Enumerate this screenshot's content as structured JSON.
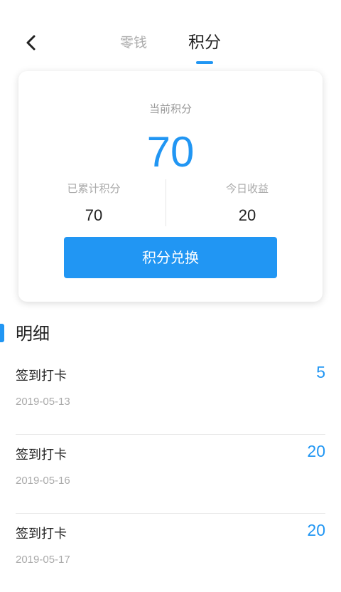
{
  "header": {
    "tabs": [
      {
        "label": "零钱",
        "active": false
      },
      {
        "label": "积分",
        "active": true
      }
    ],
    "back_icon": "chevron-left-icon"
  },
  "card": {
    "current_label": "当前积分",
    "current_value": "70",
    "stats": [
      {
        "label": "已累计积分",
        "value": "70"
      },
      {
        "label": "今日收益",
        "value": "20"
      }
    ],
    "exchange_label": "积分兑换"
  },
  "details": {
    "title": "明细",
    "items": [
      {
        "title": "签到打卡",
        "date": "2019-05-13",
        "amount": "5"
      },
      {
        "title": "签到打卡",
        "date": "2019-05-16",
        "amount": "20"
      },
      {
        "title": "签到打卡",
        "date": "2019-05-17",
        "amount": "20"
      }
    ]
  },
  "colors": {
    "accent": "#2196f3",
    "text_primary": "#222222",
    "text_secondary": "#aaaaaa"
  }
}
